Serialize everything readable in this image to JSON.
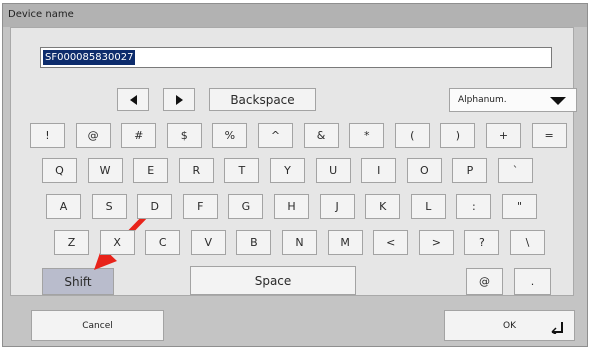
{
  "window": {
    "title": "Device name"
  },
  "input": {
    "value": "SF000085830027"
  },
  "nav": {
    "left_icon": "arrow-left-icon",
    "right_icon": "arrow-right-icon",
    "backspace": "Backspace"
  },
  "mode": {
    "selected": "Alphanum.",
    "icon": "chevron-down-icon"
  },
  "rows": {
    "row1": [
      "!",
      "@",
      "#",
      "$",
      "%",
      "^",
      "&",
      "*",
      "(",
      ")",
      "+",
      "="
    ],
    "row2": [
      "Q",
      "W",
      "E",
      "R",
      "T",
      "Y",
      "U",
      "I",
      "O",
      "P",
      "`"
    ],
    "row3": [
      "A",
      "S",
      "D",
      "F",
      "G",
      "H",
      "J",
      "K",
      "L",
      ":",
      "\""
    ],
    "row4": [
      "Z",
      "X",
      "C",
      "V",
      "B",
      "N",
      "M",
      "<",
      ">",
      "?",
      "\\"
    ]
  },
  "row5": {
    "shift": "Shift",
    "space": "Space",
    "at": "@",
    "dot": "."
  },
  "footer": {
    "cancel": "Cancel",
    "ok": "OK",
    "ok_icon": "enter-icon"
  },
  "annotation": {
    "color": "#e8231a",
    "icon": "red-arrow-icon"
  }
}
